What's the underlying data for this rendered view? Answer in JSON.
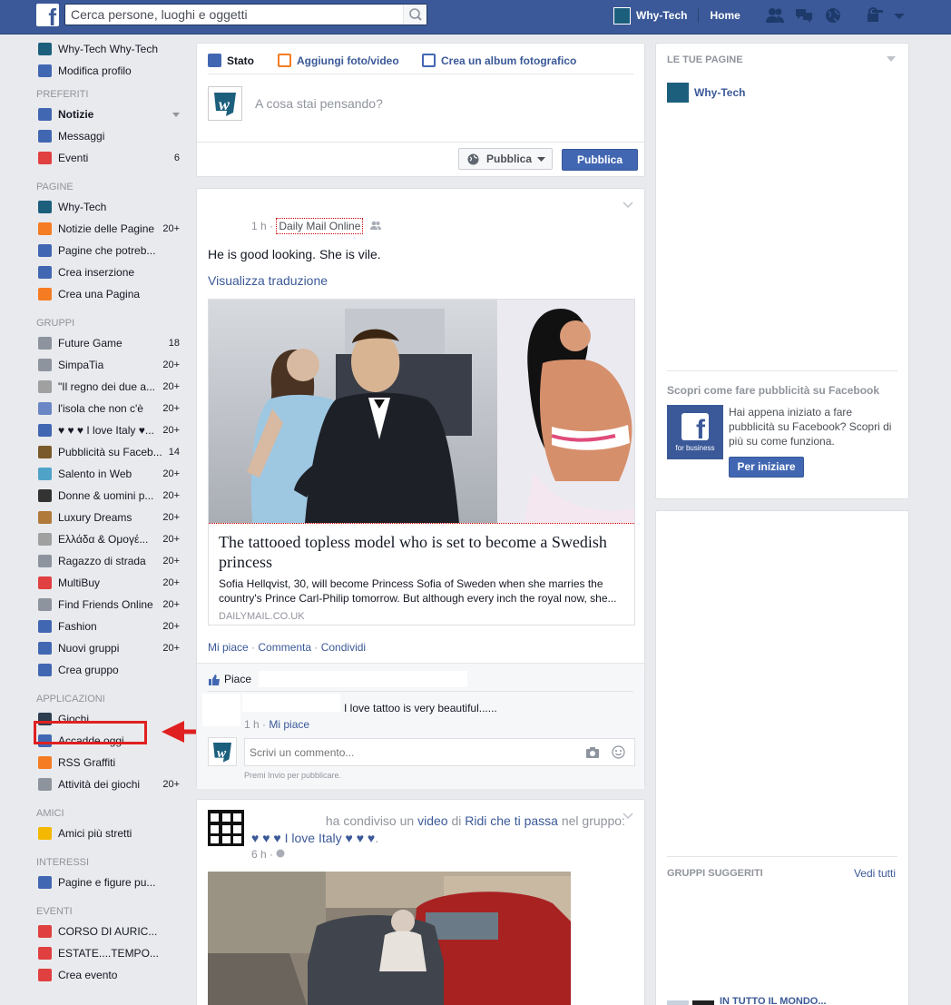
{
  "topbar": {
    "search_placeholder": "Cerca persone, luoghi e oggetti",
    "profile_name": "Why-Tech",
    "home_label": "Home"
  },
  "leftnav": {
    "profile": [
      {
        "label": "Why-Tech Why-Tech",
        "icon": "avatar",
        "color": "#1c5f7d"
      },
      {
        "label": "Modifica profilo",
        "icon": "pencil-icon",
        "color": "#4267b2"
      }
    ],
    "sections": [
      {
        "title": "Preferiti",
        "items": [
          {
            "label": "Notizie",
            "icon": "news-feed-icon",
            "color": "#4267b2",
            "bold": true,
            "chevron": true
          },
          {
            "label": "Messaggi",
            "icon": "messages-icon",
            "color": "#4267b2"
          },
          {
            "label": "Eventi",
            "icon": "calendar-icon",
            "color": "#e04040",
            "count": "6"
          }
        ]
      },
      {
        "title": "Pagine",
        "items": [
          {
            "label": "Why-Tech",
            "icon": "page-avatar-icon",
            "color": "#1c5f7d"
          },
          {
            "label": "Notizie delle Pagine",
            "icon": "flag-icon",
            "color": "#f57c22",
            "count": "20+"
          },
          {
            "label": "Pagine che potreb...",
            "icon": "thumbs-up-icon",
            "color": "#4267b2"
          },
          {
            "label": "Crea inserzione",
            "icon": "chart-icon",
            "color": "#4267b2"
          },
          {
            "label": "Crea una Pagina",
            "icon": "plus-icon",
            "color": "#f57c22"
          }
        ]
      },
      {
        "title": "Gruppi",
        "items": [
          {
            "label": "Future Game",
            "icon": "gamepad-icon",
            "color": "#8d949e",
            "count": "18"
          },
          {
            "label": "SimpaTia",
            "icon": "group-globe-icon",
            "color": "#8d949e",
            "count": "20+"
          },
          {
            "label": "\"Il regno dei due a...",
            "icon": "group-puzzle-icon",
            "color": "#a0a0a0",
            "count": "20+"
          },
          {
            "label": "l'isola che non c'è",
            "icon": "group-globe-icon",
            "color": "#6a86c4",
            "count": "20+"
          },
          {
            "label": "♥ ♥ ♥ I love Italy ♥...",
            "icon": "group-people-icon",
            "color": "#4267b2",
            "count": "20+"
          },
          {
            "label": "Pubblicità su Faceb...",
            "icon": "group-building-icon",
            "color": "#7a5a2a",
            "count": "14"
          },
          {
            "label": "Salento in Web",
            "icon": "group-beach-icon",
            "color": "#4fa3c9",
            "count": "20+"
          },
          {
            "label": "Donne & uomini p...",
            "icon": "group-disc-icon",
            "color": "#333333",
            "count": "20+"
          },
          {
            "label": "Luxury Dreams",
            "icon": "group-cookie-icon",
            "color": "#b07a3a",
            "count": "20+"
          },
          {
            "label": "Ελλάδα & Ομογέ...",
            "icon": "group-puzzle-icon",
            "color": "#a0a0a0",
            "count": "20+"
          },
          {
            "label": "Ragazzo di strada",
            "icon": "group-globe-icon",
            "color": "#8d949e",
            "count": "20+"
          },
          {
            "label": "MultiBuy",
            "icon": "gift-icon",
            "color": "#e04040",
            "count": "20+"
          },
          {
            "label": "Find Friends Online",
            "icon": "group-hands-icon",
            "color": "#8d949e",
            "count": "20+"
          },
          {
            "label": "Fashion",
            "icon": "group-people-icon",
            "color": "#4267b2",
            "count": "20+"
          },
          {
            "label": "Nuovi gruppi",
            "icon": "group-people-icon",
            "color": "#4267b2",
            "count": "20+"
          },
          {
            "label": "Crea gruppo",
            "icon": "plus-icon",
            "color": "#4267b2"
          }
        ]
      },
      {
        "title": "Applicazioni",
        "items": [
          {
            "label": "Giochi",
            "icon": "games-icon",
            "color": "#2c3e50"
          },
          {
            "label": "Accadde oggi",
            "icon": "clock-icon",
            "color": "#4267b2"
          },
          {
            "label": "RSS Graffiti",
            "icon": "cube-icon",
            "color": "#f57c22"
          },
          {
            "label": "Attività dei giochi",
            "icon": "gamepad-icon",
            "color": "#8d949e",
            "count": "20+"
          }
        ]
      },
      {
        "title": "Amici",
        "items": [
          {
            "label": "Amici più stretti",
            "icon": "star-icon",
            "color": "#f5b800"
          }
        ]
      },
      {
        "title": "Interessi",
        "items": [
          {
            "label": "Pagine e figure pu...",
            "icon": "rss-icon",
            "color": "#4267b2"
          }
        ]
      },
      {
        "title": "Eventi",
        "items": [
          {
            "label": "CORSO DI AURIC...",
            "icon": "calendar-icon",
            "color": "#e04040"
          },
          {
            "label": "ESTATE....TEMPO...",
            "icon": "calendar-icon",
            "color": "#e04040"
          },
          {
            "label": "Crea evento",
            "icon": "calendar-plus-icon",
            "color": "#e04040"
          }
        ]
      }
    ]
  },
  "composer": {
    "tabs": [
      {
        "label": "Stato",
        "icon": "pencil-icon",
        "color": "#4267b2"
      },
      {
        "label": "Aggiungi foto/video",
        "icon": "photo-icon",
        "color": "#f57c22"
      },
      {
        "label": "Crea un album fotografico",
        "icon": "album-icon",
        "color": "#4267b2"
      }
    ],
    "placeholder": "A cosa stai pensando?",
    "privacy_label": "Pubblica",
    "publish_label": "Pubblica"
  },
  "post1": {
    "time": "1 h",
    "source": "Daily Mail Online",
    "text": "He is good looking. She is vile.",
    "translate": "Visualizza traduzione",
    "link_title": "The tattooed topless model who is set to become a Swedish princess",
    "link_desc": "Sofia Hellqvist, 30, will become Princess Sofia of Sweden when she marries the country's Prince Carl-Philip tomorrow. But although every inch the royal now, she...",
    "link_domain": "DAILYMAIL.CO.UK",
    "actions": [
      "Mi piace",
      "Commenta",
      "Condividi"
    ],
    "likes_label": "Piace",
    "comment_text": "I love tattoo is very beautiful......",
    "comment_time": "1 h",
    "comment_like": "Mi piace",
    "comment_placeholder": "Scrivi un commento...",
    "comment_hint": "Premi Invio per pubblicare."
  },
  "post2": {
    "shared": "ha condiviso un",
    "video": "video",
    "of": "di",
    "page": "Ridi che ti passa",
    "in": "nel",
    "group_prefix": "gruppo:",
    "group": "♥ ♥ ♥ I love Italy ♥ ♥ ♥",
    "time": "6 h"
  },
  "right": {
    "pages_title": "LE TUE PAGINE",
    "page_name": "Why-Tech",
    "ad_title": "Scopri come fare pubblicità su Facebook",
    "ad_text": "Hai appena iniziato a fare pubblicità su Facebook? Scopri di più su come funziona.",
    "ad_logo_text": "for business",
    "ad_button": "Per iniziare",
    "groups_title": "GRUPPI SUGGERITI",
    "see_all": "Vedi tutti",
    "cut_text": "IN TUTTO IL MONDO..."
  }
}
